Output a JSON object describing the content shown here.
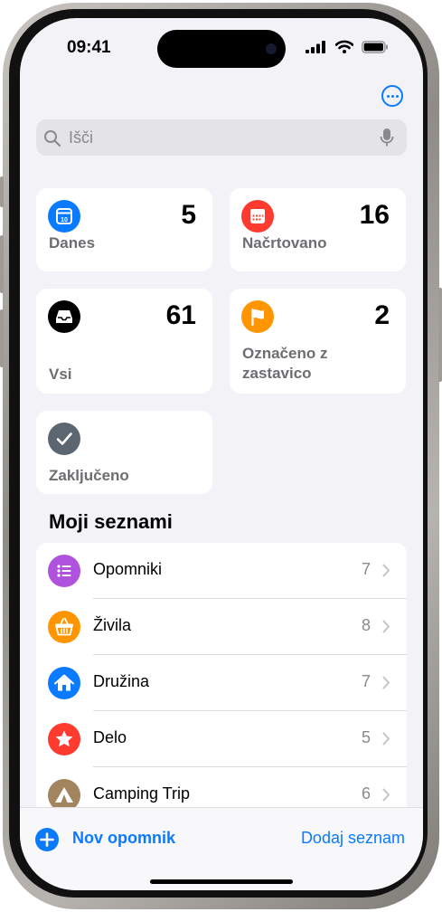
{
  "status_bar": {
    "time": "09:41"
  },
  "search": {
    "placeholder": "Išči"
  },
  "smart_lists": [
    {
      "label": "Danes",
      "count": "5",
      "color": "#0a7aff",
      "icon": "calendar-today-icon"
    },
    {
      "label": "Načrtovano",
      "count": "16",
      "color": "#ff3b30",
      "icon": "calendar-icon"
    },
    {
      "label": "Vsi",
      "count": "61",
      "color": "#000000",
      "icon": "tray-icon"
    },
    {
      "label": "Označeno z zastavico",
      "count": "2",
      "color": "#ff9500",
      "icon": "flag-icon"
    },
    {
      "label": "Zaključeno",
      "count": "",
      "color": "#5b6670",
      "icon": "checkmark-icon"
    }
  ],
  "my_lists": {
    "title": "Moji seznami",
    "items": [
      {
        "name": "Opomniki",
        "count": "7",
        "color": "#af52de",
        "icon": "list-bullet-icon"
      },
      {
        "name": "Živila",
        "count": "8",
        "color": "#ff9500",
        "icon": "basket-icon"
      },
      {
        "name": "Družina",
        "count": "7",
        "color": "#0a7aff",
        "icon": "house-icon"
      },
      {
        "name": "Delo",
        "count": "5",
        "color": "#ff3b30",
        "icon": "star-icon"
      },
      {
        "name": "Camping Trip",
        "count": "6",
        "color": "#a2845e",
        "icon": "tent-icon"
      }
    ]
  },
  "toolbar": {
    "new_reminder": "Nov opomnik",
    "add_list": "Dodaj seznam"
  },
  "colors": {
    "accent": "#0a7aff",
    "background": "#f2f2f7"
  }
}
